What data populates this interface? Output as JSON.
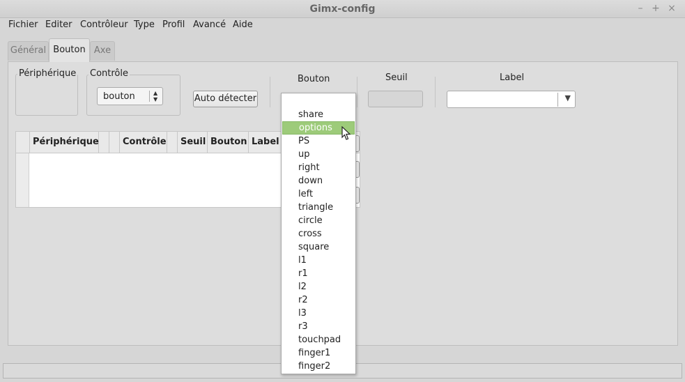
{
  "window": {
    "title": "Gimx-config"
  },
  "menu": [
    "Fichier",
    "Editer",
    "Contrôleur",
    "Type",
    "Profil",
    "Avancé",
    "Aide"
  ],
  "tabs": [
    "Général",
    "Bouton",
    "Axe"
  ],
  "panel": {
    "peripherique_label": "Périphérique",
    "controle_label": "Contrôle",
    "controle_value": "bouton",
    "auto_detect_label": "Auto détecter",
    "bouton_label": "Bouton",
    "seuil_label": "Seuil",
    "label_label": "Label"
  },
  "table": {
    "headers": [
      "Périphérique",
      "Contrôle",
      "Seuil",
      "Bouton",
      "Label"
    ]
  },
  "dropdown": {
    "items": [
      "share",
      "options",
      "PS",
      "up",
      "right",
      "down",
      "left",
      "triangle",
      "circle",
      "cross",
      "square",
      "l1",
      "r1",
      "l2",
      "r2",
      "l3",
      "r3",
      "touchpad",
      "finger1",
      "finger2"
    ],
    "selected": "options"
  },
  "colors": {
    "selection": "#9dcb7a"
  }
}
